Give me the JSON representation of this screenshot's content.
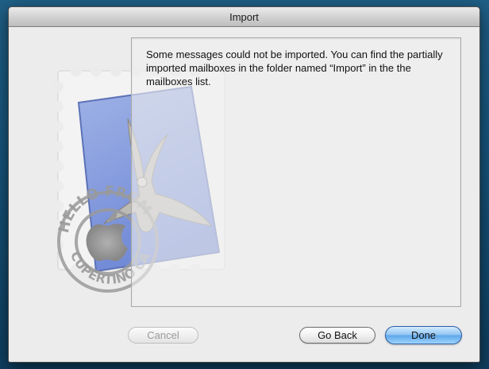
{
  "window": {
    "title": "Import"
  },
  "message": {
    "text": "Some messages could not be imported. You can find the partially imported mailboxes in the folder named “Import” in the the mailboxes list."
  },
  "buttons": {
    "cancel": "Cancel",
    "go_back": "Go Back",
    "done": "Done"
  },
  "stamp": {
    "postmark_top": "HELLO FROM",
    "postmark_bottom": "CUPERTINO CA"
  }
}
